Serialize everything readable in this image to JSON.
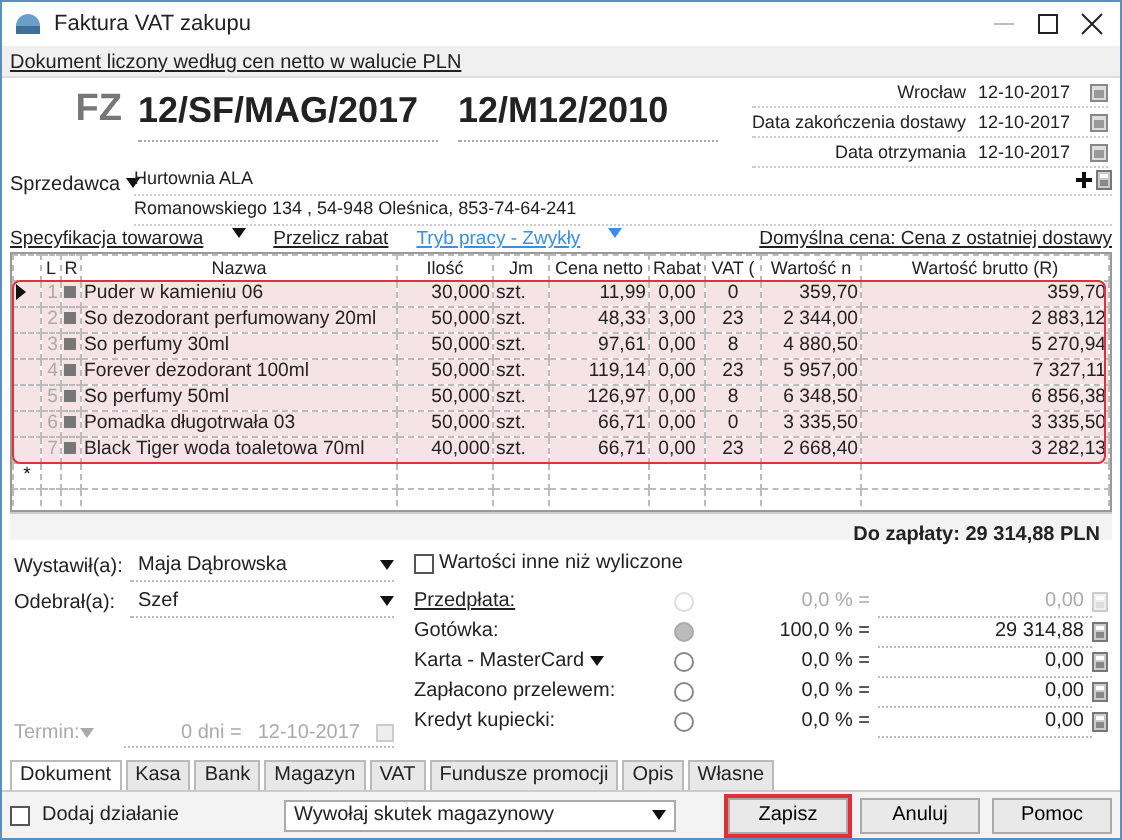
{
  "window": {
    "title": "Faktura VAT zakupu"
  },
  "notice": "Dokument liczony według cen netto w walucie PLN",
  "document": {
    "type": "FZ",
    "number": "12/SF/MAG/2017",
    "external_number": "12/M12/2010"
  },
  "dates": [
    {
      "label": "Wrocław",
      "value": "12-10-2017"
    },
    {
      "label": "Data zakończenia dostawy",
      "value": "12-10-2017"
    },
    {
      "label": "Data otrzymania",
      "value": "12-10-2017"
    }
  ],
  "seller": {
    "label": "Sprzedawca",
    "name": "Hurtownia ALA",
    "address": "Romanowskiego 134 , 54-948 Oleśnica, 853-74-64-241"
  },
  "toolbar": {
    "specification": "Specyfikacja towarowa",
    "recalc": "Przelicz rabat",
    "mode": "Tryb pracy - Zwykły",
    "default_price": "Domyślna cena: Cena z ostatniej dostawy"
  },
  "table": {
    "highlighted": true,
    "columns": [
      "L",
      "R",
      "Nazwa",
      "Ilość",
      "Jm",
      "Cena netto",
      "Rabat",
      "VAT (",
      "Wartość n",
      "Wartość brutto (R)"
    ],
    "rows": [
      {
        "current": true,
        "cells": [
          "1",
          "",
          "Puder w kamieniu 06",
          "30,000",
          "szt.",
          "11,99",
          "0,00",
          "0",
          "359,70",
          "359,70"
        ]
      },
      {
        "current": false,
        "cells": [
          "2",
          "",
          "So dezodorant perfumowany 20ml",
          "50,000",
          "szt.",
          "48,33",
          "3,00",
          "23",
          "2 344,00",
          "2 883,12"
        ]
      },
      {
        "current": false,
        "cells": [
          "3",
          "",
          "So perfumy 30ml",
          "50,000",
          "szt.",
          "97,61",
          "0,00",
          "8",
          "4 880,50",
          "5 270,94"
        ]
      },
      {
        "current": false,
        "cells": [
          "4",
          "",
          "Forever dezodorant 100ml",
          "50,000",
          "szt.",
          "119,14",
          "0,00",
          "23",
          "5 957,00",
          "7 327,11"
        ]
      },
      {
        "current": false,
        "cells": [
          "5",
          "",
          "So perfumy 50ml",
          "50,000",
          "szt.",
          "126,97",
          "0,00",
          "8",
          "6 348,50",
          "6 856,38"
        ]
      },
      {
        "current": false,
        "cells": [
          "6",
          "",
          "Pomadka długotrwała 03",
          "50,000",
          "szt.",
          "66,71",
          "0,00",
          "0",
          "3 335,50",
          "3 335,50"
        ]
      },
      {
        "current": false,
        "cells": [
          "7",
          "",
          "Black Tiger woda toaletowa 70ml",
          "40,000",
          "szt.",
          "66,71",
          "0,00",
          "23",
          "2 668,40",
          "3 282,13"
        ]
      }
    ],
    "new_row_marker": "*"
  },
  "total": "Do zapłaty: 29 314,88 PLN",
  "issuer": {
    "label": "Wystawił(a):",
    "value": "Maja Dąbrowska"
  },
  "receiver": {
    "label": "Odebrał(a):",
    "value": "Szef"
  },
  "term": {
    "label": "Termin:",
    "days": "0 dni =",
    "date": "12-10-2017",
    "disabled": true
  },
  "other_values": {
    "label": "Wartości inne niż wyliczone",
    "checked": false
  },
  "payments": [
    {
      "kind": "link",
      "label": "Przedpłata:",
      "selected": false,
      "disabled": true,
      "percent": "0,0 % =",
      "amount": "0,00"
    },
    {
      "kind": "plain",
      "label": "Gotówka:",
      "selected": true,
      "disabled": false,
      "percent": "100,0 % =",
      "amount": "29 314,88"
    },
    {
      "kind": "dropdown",
      "label": "Karta - MasterCard",
      "selected": false,
      "disabled": false,
      "percent": "0,0 % =",
      "amount": "0,00"
    },
    {
      "kind": "plain",
      "label": "Zapłacono przelewem:",
      "selected": false,
      "disabled": false,
      "percent": "0,0 % =",
      "amount": "0,00"
    },
    {
      "kind": "plain",
      "label": "Kredyt kupiecki:",
      "selected": false,
      "disabled": false,
      "percent": "0,0 % =",
      "amount": "0,00"
    }
  ],
  "tabs": [
    {
      "label": "Dokument",
      "selected": true
    },
    {
      "label": "Kasa",
      "selected": false
    },
    {
      "label": "Bank",
      "selected": false
    },
    {
      "label": "Magazyn",
      "selected": false
    },
    {
      "label": "VAT",
      "selected": false
    },
    {
      "label": "Fundusze promocji",
      "selected": false
    },
    {
      "label": "Opis",
      "selected": false
    },
    {
      "label": "Własne",
      "selected": false
    }
  ],
  "add_action": {
    "label": "Dodaj działanie",
    "checked": false
  },
  "effect": {
    "value": "Wywołaj skutek magazynowy"
  },
  "buttons": [
    {
      "label": "Zapisz",
      "highlighted": true
    },
    {
      "label": "Anuluj",
      "highlighted": false
    },
    {
      "label": "Pomoc",
      "highlighted": false
    }
  ]
}
